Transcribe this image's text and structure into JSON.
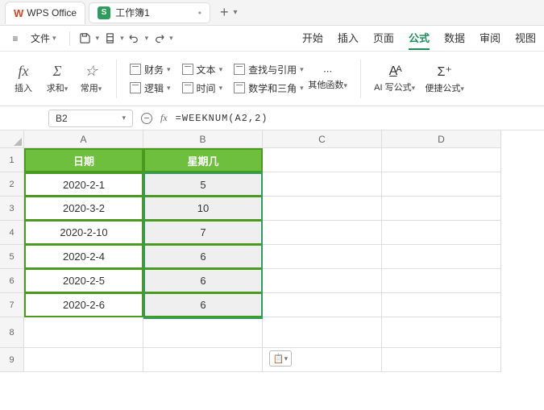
{
  "app": {
    "name": "WPS Office"
  },
  "doc": {
    "title": "工作簿1"
  },
  "menubar": {
    "file": "文件"
  },
  "tabs": {
    "start": "开始",
    "insert": "插入",
    "page": "页面",
    "formula": "公式",
    "data": "数据",
    "review": "审阅",
    "view": "视图"
  },
  "ribbon": {
    "insert_fn": "插入",
    "sum": "求和",
    "common": "常用",
    "finance": "财务",
    "text": "文本",
    "lookup": "查找与引用",
    "logic": "逻辑",
    "datetime": "时间",
    "math": "数学和三角",
    "other": "其他函数",
    "ai": "AI 写公式",
    "quick": "便捷公式"
  },
  "namebox": {
    "ref": "B2"
  },
  "formula_bar": {
    "fx": "fx",
    "content": "=WEEKNUM(A2,2)"
  },
  "cols": [
    "A",
    "B",
    "C",
    "D"
  ],
  "header_row": {
    "a": "日期",
    "b": "星期几"
  },
  "data_rows": [
    {
      "a": "2020-2-1",
      "b": "5"
    },
    {
      "a": "2020-3-2",
      "b": "10"
    },
    {
      "a": "2020-2-10",
      "b": "7"
    },
    {
      "a": "2020-2-4",
      "b": "6"
    },
    {
      "a": "2020-2-5",
      "b": "6"
    },
    {
      "a": "2020-2-6",
      "b": "6"
    }
  ],
  "chart_data": {
    "type": "table",
    "columns": [
      "日期",
      "星期几"
    ],
    "rows": [
      [
        "2020-2-1",
        5
      ],
      [
        "2020-3-2",
        10
      ],
      [
        "2020-2-10",
        7
      ],
      [
        "2020-2-4",
        6
      ],
      [
        "2020-2-5",
        6
      ],
      [
        "2020-2-6",
        6
      ]
    ]
  }
}
